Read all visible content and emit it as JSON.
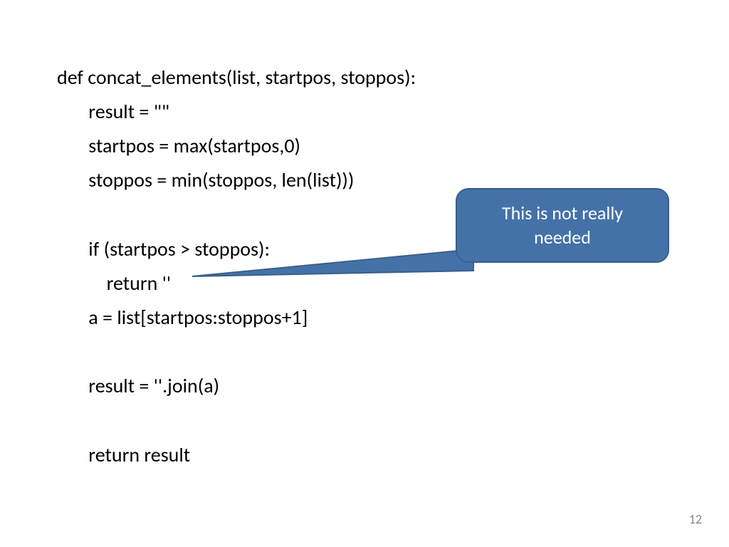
{
  "code": {
    "l1": "def concat_elements(list, startpos, stoppos):",
    "l2": "       result = \"\"",
    "l3": "       startpos = max(startpos,0)",
    "l4": "       stoppos = min(stoppos, len(list)))",
    "l5": "",
    "l6": "       if (startpos > stoppos):",
    "l7": "           return ''",
    "l8": "       a = list[startpos:stoppos+1]",
    "l9": "",
    "l10": "       result = ''.join(a)",
    "l11": "",
    "l12": "       return result"
  },
  "callout": {
    "text_line1": "This is not really",
    "text_line2": "needed",
    "fill": "#4472A8",
    "border": "#3A5F8A"
  },
  "page_number": "12"
}
